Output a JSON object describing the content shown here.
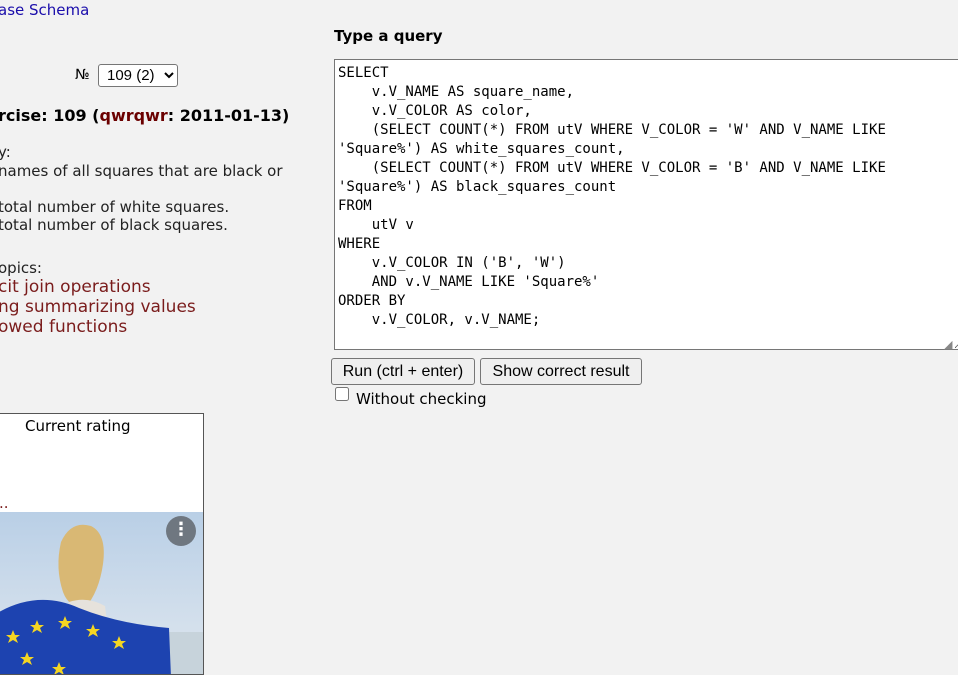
{
  "header": {
    "schema_link": "ase Schema"
  },
  "exercise": {
    "number_label": "№",
    "select_value": "109 (2)",
    "title_prefix": "rcise: 109 (",
    "author": "qwrqwr",
    "title_suffix": ": 2011-01-13)",
    "task_label": "y:",
    "task_lines": [
      " names of all squares that are black or",
      " total number of white squares.",
      " total number of black squares."
    ],
    "topics_label": "opics:",
    "topics": [
      "cit join operations",
      "ng summarizing values",
      "owed functions"
    ]
  },
  "rating": {
    "title": "Current rating",
    "more": "..",
    "ad_menu_icon": "more-vert-icon"
  },
  "query": {
    "heading": "Type a query",
    "text": "SELECT\n    v.V_NAME AS square_name,\n    v.V_COLOR AS color,\n    (SELECT COUNT(*) FROM utV WHERE V_COLOR = 'W' AND V_NAME LIKE\n'Square%') AS white_squares_count,\n    (SELECT COUNT(*) FROM utV WHERE V_COLOR = 'B' AND V_NAME LIKE\n'Square%') AS black_squares_count\nFROM\n    utV v\nWHERE\n    v.V_COLOR IN ('B', 'W')\n    AND v.V_NAME LIKE 'Square%'\nORDER BY\n    v.V_COLOR, v.V_NAME;",
    "run_label": "Run (ctrl + enter)",
    "show_result_label": "Show correct result",
    "without_checking_label": "Without checking",
    "without_checking_checked": false
  }
}
